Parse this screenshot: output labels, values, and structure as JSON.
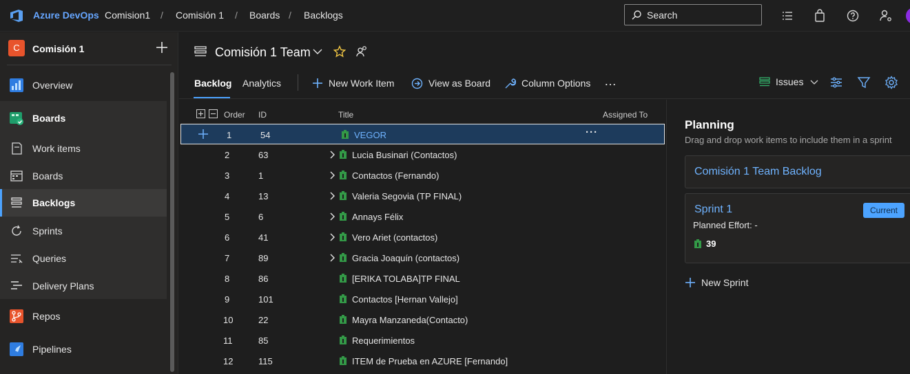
{
  "topbar": {
    "brand": "Azure DevOps",
    "breadcrumbs": [
      "Comision1",
      "Comisión 1",
      "Boards",
      "Backlogs"
    ],
    "search_label": "Search"
  },
  "sidebar": {
    "project_badge": "C",
    "project_name": "Comisión 1",
    "items": [
      {
        "label": "Overview"
      },
      {
        "label": "Boards"
      },
      {
        "label": "Work items"
      },
      {
        "label": "Boards"
      },
      {
        "label": "Backlogs"
      },
      {
        "label": "Sprints"
      },
      {
        "label": "Queries"
      },
      {
        "label": "Delivery Plans"
      },
      {
        "label": "Repos"
      },
      {
        "label": "Pipelines"
      }
    ]
  },
  "header": {
    "team_name": "Comisión 1 Team"
  },
  "toolbar": {
    "tab_backlog": "Backlog",
    "tab_analytics": "Analytics",
    "new_work_item": "New Work Item",
    "view_as_board": "View as Board",
    "column_options": "Column Options",
    "more": "…",
    "issues": "Issues"
  },
  "grid": {
    "columns": {
      "order": "Order",
      "id": "ID",
      "title": "Title",
      "assigned_to": "Assigned To"
    },
    "rows": [
      {
        "order": "1",
        "id": "54",
        "title": "VEGOR",
        "expandable": false,
        "selected": true
      },
      {
        "order": "2",
        "id": "63",
        "title": "Lucia Businari (Contactos)",
        "expandable": true
      },
      {
        "order": "3",
        "id": "1",
        "title": "Contactos (Fernando)",
        "expandable": true
      },
      {
        "order": "4",
        "id": "13",
        "title": "Valeria Segovia (TP FINAL)",
        "expandable": true
      },
      {
        "order": "5",
        "id": "6",
        "title": "Annays Félix",
        "expandable": true
      },
      {
        "order": "6",
        "id": "41",
        "title": "Vero Ariet (contactos)",
        "expandable": true
      },
      {
        "order": "7",
        "id": "89",
        "title": "Gracia Joaquín (contactos)",
        "expandable": true
      },
      {
        "order": "8",
        "id": "86",
        "title": "[ERIKA TOLABA]TP FINAL",
        "expandable": false
      },
      {
        "order": "9",
        "id": "101",
        "title": "Contactos [Hernan Vallejo]",
        "expandable": false
      },
      {
        "order": "10",
        "id": "22",
        "title": "Mayra Manzaneda(Contacto)",
        "expandable": false
      },
      {
        "order": "11",
        "id": "85",
        "title": "Requerimientos",
        "expandable": false
      },
      {
        "order": "12",
        "id": "115",
        "title": "ITEM de Prueba en AZURE [Fernando]",
        "expandable": false
      }
    ]
  },
  "planning": {
    "title": "Planning",
    "subtitle": "Drag and drop work items to include them in a sprint",
    "backlog_card": "Comisión 1 Team Backlog",
    "sprint_name": "Sprint 1",
    "current_badge": "Current",
    "planned_effort": "Planned Effort: -",
    "item_count": "39",
    "new_sprint": "New Sprint"
  },
  "colors": {
    "accent": "#4ca3ff",
    "work_item_green": "#339947",
    "project_badge": "#e8542c"
  }
}
